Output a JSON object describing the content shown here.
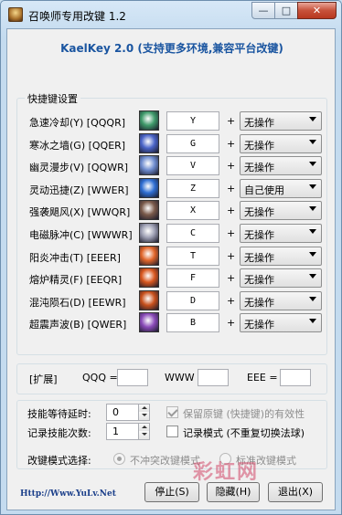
{
  "window": {
    "title": "召唤师专用改键 1.2",
    "buttons": {
      "minimize": "—",
      "maximize": "□",
      "close": "✕"
    }
  },
  "header": {
    "title": "KaelKey 2.0 (支持更多环境,兼容平台改键)"
  },
  "hotkeys_group": {
    "label": "快捷键设置",
    "rows": [
      {
        "label": "急速冷却(Y) [QQQR]",
        "key": "Y",
        "action": "无操作",
        "icon": "cold-snap-icon",
        "color": "#3f9a6a"
      },
      {
        "label": "寒冰之墙(G) [QQER]",
        "key": "G",
        "action": "无操作",
        "icon": "ice-wall-icon",
        "color": "#4a64c8"
      },
      {
        "label": "幽灵漫步(V) [QQWR]",
        "key": "V",
        "action": "无操作",
        "icon": "ghost-walk-icon",
        "color": "#6e8ccf"
      },
      {
        "label": "灵动迅捷(Z) [WWER]",
        "key": "Z",
        "action": "自己使用",
        "icon": "alacrity-icon",
        "color": "#2f6ed2"
      },
      {
        "label": "强袭飓风(X) [WWQR]",
        "key": "X",
        "action": "无操作",
        "icon": "tornado-icon",
        "color": "#7a5a4a"
      },
      {
        "label": "电磁脉冲(C) [WWWR]",
        "key": "C",
        "action": "无操作",
        "icon": "emp-icon",
        "color": "#9d9fb3"
      },
      {
        "label": "阳炎冲击(T) [EEER]",
        "key": "T",
        "action": "无操作",
        "icon": "sun-strike-icon",
        "color": "#e0652a"
      },
      {
        "label": "熔炉精灵(F) [EEQR]",
        "key": "F",
        "action": "无操作",
        "icon": "forge-spirit-icon",
        "color": "#d9571e"
      },
      {
        "label": "混沌陨石(D) [EEWR]",
        "key": "D",
        "action": "无操作",
        "icon": "chaos-meteor-icon",
        "color": "#c8501c"
      },
      {
        "label": "超震声波(B) [QWER]",
        "key": "B",
        "action": "无操作",
        "icon": "deafening-blast-icon",
        "color": "#8a4ab8"
      }
    ],
    "plus": "+"
  },
  "extend": {
    "label": "[扩展]",
    "qqq_label": "QQQ =",
    "qqq_value": "",
    "www_label": "WWW",
    "www_value": "",
    "eee_label": "EEE =",
    "eee_value": ""
  },
  "options": {
    "delay_label": "技能等待延时:",
    "delay_value": "0",
    "count_label": "记录技能次数:",
    "count_value": "1",
    "keep_original_label": "保留原键 (快捷键)的有效性",
    "record_mode_label": "记录模式 (不重复切换法球)"
  },
  "mode": {
    "label": "改键模式选择:",
    "option_a": "不冲突改键模式",
    "option_b": "标准改键模式"
  },
  "footer": {
    "link": "Http://Www.YuLv.Net",
    "stop": "停止(S)",
    "hide": "隐藏(H)",
    "exit": "退出(X)"
  },
  "watermark": "彩虹网"
}
